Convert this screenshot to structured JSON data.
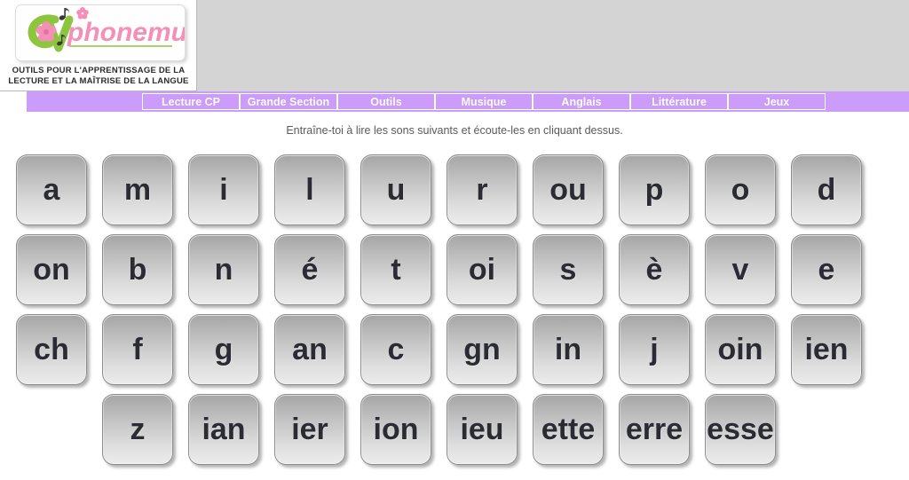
{
  "site": {
    "logo_text": "phonemus.fr",
    "logo_letter_c": "C",
    "logo_letter_v": "V",
    "logo_green": "#8cc63f",
    "logo_pink": "#f48fb7",
    "tagline_line1": "OUTILS POUR L'APPRENTISSAGE DE LA",
    "tagline_line2": "LECTURE ET LA MAÎTRISE DE LA LANGUE",
    "header_bg": "#d4d4d4"
  },
  "nav": {
    "bg_color": "#cc9cfb",
    "items": [
      {
        "label": "Lecture CP"
      },
      {
        "label": "Grande Section"
      },
      {
        "label": "Outils"
      },
      {
        "label": "Musique"
      },
      {
        "label": "Anglais"
      },
      {
        "label": "Littérature"
      },
      {
        "label": "Jeux"
      }
    ]
  },
  "main": {
    "instruction": "Entraîne-toi à lire les sons suivants et écoute-les en cliquant dessus.",
    "key_rows": [
      {
        "start_col": 0,
        "keys": [
          "a",
          "m",
          "i",
          "l",
          "u",
          "r",
          "ou",
          "p",
          "o",
          "d"
        ]
      },
      {
        "start_col": 0,
        "keys": [
          "on",
          "b",
          "n",
          "é",
          "t",
          "oi",
          "s",
          "è",
          "v",
          "e"
        ]
      },
      {
        "start_col": 0,
        "keys": [
          "ch",
          "f",
          "g",
          "an",
          "c",
          "gn",
          "in",
          "j",
          "oin",
          "ien"
        ]
      },
      {
        "start_col": 1,
        "keys": [
          "z",
          "ian",
          "ier",
          "ion",
          "ieu",
          "ette",
          "erre",
          "esse"
        ]
      }
    ]
  }
}
